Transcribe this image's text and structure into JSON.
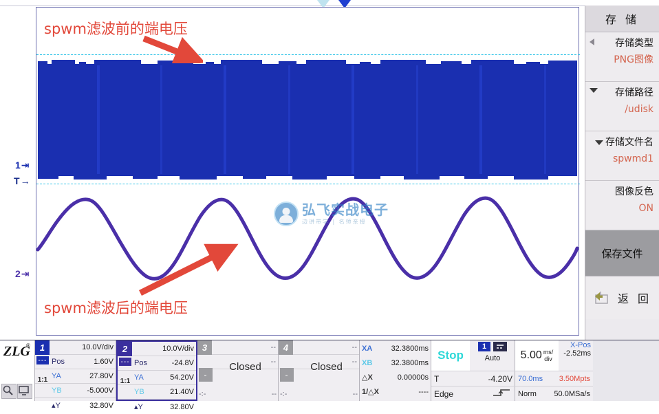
{
  "annotations": {
    "top": "spwm滤波前的端电压",
    "bottom": "spwm滤波后的端电压"
  },
  "plot": {
    "ch1_marker": "1",
    "trigger_marker": "T",
    "ch2_marker": "2"
  },
  "watermark": {
    "main": "弘飞实战电子",
    "sub": "边讲带学 | 名师亲授"
  },
  "side_menu": {
    "title": "存 储",
    "items": [
      {
        "label": "存储类型",
        "value": "PNG图像",
        "caret": "left"
      },
      {
        "label": "存储路径",
        "value": "/udisk",
        "caret": "down"
      },
      {
        "label": "存储文件名",
        "value": "spwmd1",
        "caret": "down-inline"
      },
      {
        "label": "图像反色",
        "value": "ON",
        "caret": "none"
      }
    ],
    "action": "保存文件",
    "back": "返 回"
  },
  "channels": [
    {
      "num": "1",
      "scale": "10.0V/div",
      "pos_label": "Pos",
      "pos": "1.60V",
      "ya_label": "YA",
      "ya": "27.80V",
      "yb_label": "YB",
      "yb": "-5.000V",
      "dy_label": "▴Y",
      "dy": "32.80V",
      "ratio": "1:1",
      "coupling": "---",
      "closed": false,
      "active": false,
      "color": "#1a2fb0"
    },
    {
      "num": "2",
      "scale": "10.0V/div",
      "pos_label": "Pos",
      "pos": "-24.8V",
      "ya_label": "YA",
      "ya": "54.20V",
      "yb_label": "YB",
      "yb": "21.40V",
      "dy_label": "▴Y",
      "dy": "32.80V",
      "ratio": "1:1",
      "coupling": "---",
      "closed": false,
      "active": true,
      "color": "#3b2f9e"
    },
    {
      "num": "3",
      "scale": "--",
      "pos_label": "",
      "pos": "--",
      "ya_label": "",
      "ya": "",
      "yb_label": "",
      "yb": "",
      "dy_label": "-:-",
      "dy": "--",
      "ratio": "",
      "coupling": "-",
      "closed": true,
      "closed_text": "Closed",
      "active": false,
      "color": "#9c9ca0"
    },
    {
      "num": "4",
      "scale": "--",
      "pos_label": "",
      "pos": "--",
      "ya_label": "",
      "ya": "",
      "yb_label": "",
      "yb": "",
      "dy_label": "-:-",
      "dy": "--",
      "ratio": "",
      "coupling": "-",
      "closed": true,
      "closed_text": "Closed",
      "active": false,
      "color": "#9c9ca0"
    }
  ],
  "measurements": [
    {
      "key": "XA",
      "value": "32.3800ms"
    },
    {
      "key": "XB",
      "value": "32.3800ms"
    },
    {
      "key": "△X",
      "value": "0.00000s"
    },
    {
      "key": "1/△X",
      "value": "----"
    }
  ],
  "trigger": {
    "status": "Stop",
    "source": "1",
    "mode": "Auto",
    "level_label": "T",
    "level": "-4.20V",
    "type": "Edge",
    "slope": "rising"
  },
  "timebase": {
    "value": "5.00",
    "unit_top": "ms/",
    "unit_bottom": "div",
    "xpos_label": "X-Pos",
    "xpos": "-2.52ms",
    "window": "70.0ms",
    "memory": "3.50Mpts",
    "acq_mode": "Norm",
    "sample_rate": "50.0MSa/s"
  },
  "colors": {
    "ch1": "#1a2fb0",
    "ch2": "#4a2fa8",
    "annotation": "#e2483a",
    "cursor": "#35c5e8",
    "accent_value": "#d4654f"
  }
}
